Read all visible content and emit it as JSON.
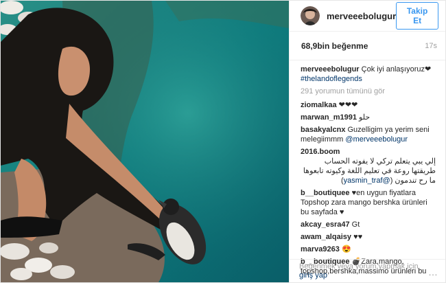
{
  "header": {
    "username": "merveeebolugur",
    "follow_label": "Takip Et"
  },
  "post": {
    "likes": "68,9bin beğenme",
    "time": "17s"
  },
  "caption": {
    "username": "merveeebolugur",
    "text": "Çok iyi anlaşıyoruz❤",
    "hashtag": "#thelandoflegends"
  },
  "load_more": "291 yorumun tümünü gör",
  "comments": [
    {
      "user": "ziomalkaa",
      "text": "❤❤❤"
    },
    {
      "user": "marwan_m1991",
      "text": "حلو"
    },
    {
      "user": "basakyalcnx",
      "text": "Guzelligim ya yerim seni melegiimmm",
      "mention": "@merveeebolugur"
    },
    {
      "user": "2016.boom",
      "text": "إلي يبي يتعلم تركي لا يفوته الحساب طريقتها روعة في تعليم اللغة وكيوته تابعوها ما رح تندمون",
      "mention": "@yasmin_traf"
    },
    {
      "user": "b__boutiquee",
      "text": "♥en uygun fiyatlara Topshop zara mango bershka ürünleri bu sayfada ♥"
    },
    {
      "user": "akcay_esra47",
      "text": "Gt"
    },
    {
      "user": "awam_alqaisy",
      "text": "♥♥"
    },
    {
      "user": "marva9263",
      "text": "😍"
    },
    {
      "user": "b__boutiquee",
      "text": "💣Zara,mango, topshop,bershka,massimo ürünleri bu"
    }
  ],
  "footer": {
    "text": "Beğenmek veya yorum yapmak için",
    "login": "giriş yap",
    "more_icon": "…"
  },
  "colors": {
    "link": "#003569",
    "accent": "#3897f0",
    "muted": "#a0a0a0",
    "water": "#0e6f73"
  }
}
